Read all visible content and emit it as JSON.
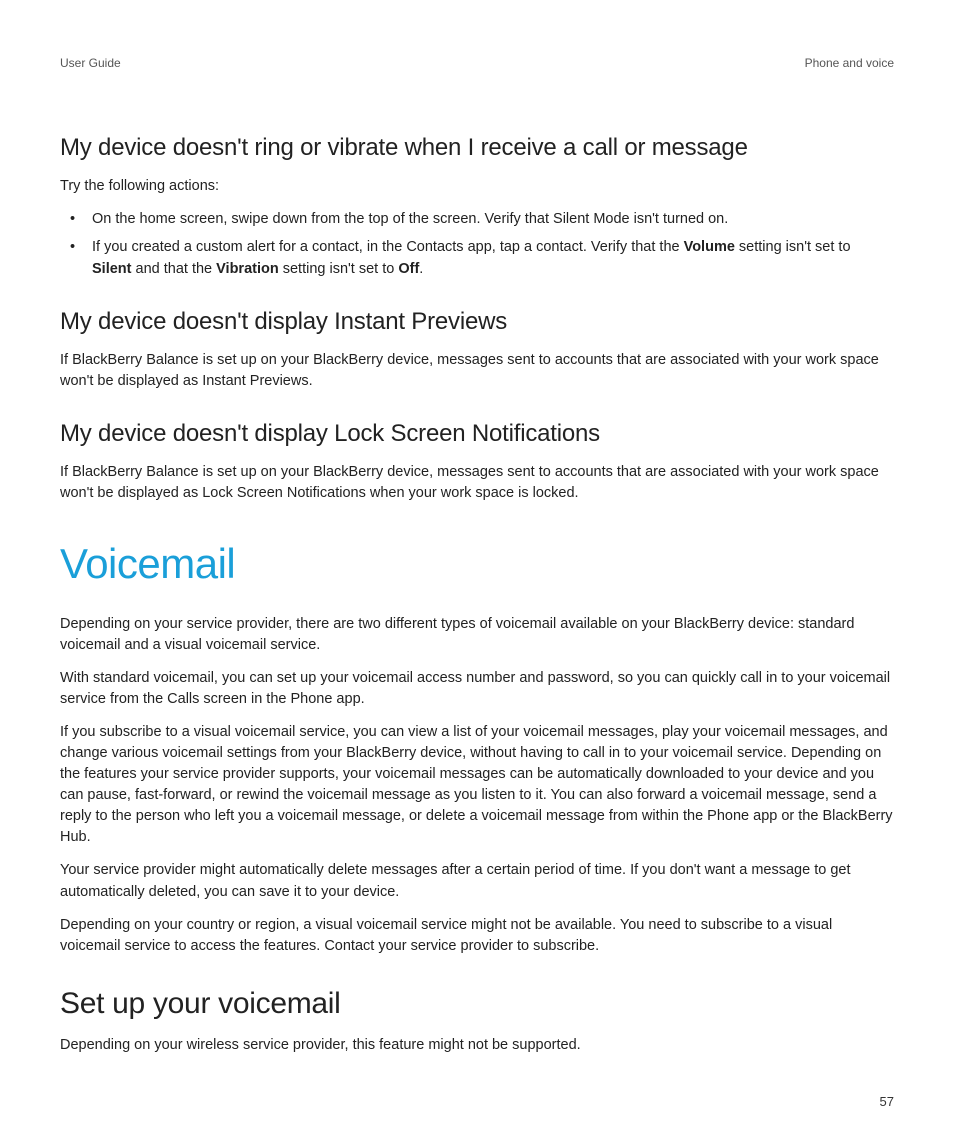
{
  "header": {
    "left": "User Guide",
    "right": "Phone and voice"
  },
  "section1": {
    "title": "My device doesn't ring or vibrate when I receive a call or message",
    "intro": "Try the following actions:",
    "bullet1": "On the home screen, swipe down from the top of the screen. Verify that Silent Mode isn't turned on.",
    "bullet2": {
      "p1": "If you created a custom alert for a contact, in the Contacts app, tap a contact. Verify that the ",
      "b1": "Volume",
      "p2": " setting isn't set to ",
      "b2": "Silent",
      "p3": " and that the ",
      "b3": "Vibration",
      "p4": " setting isn't set to ",
      "b4": "Off",
      "p5": "."
    }
  },
  "section2": {
    "title": "My device doesn't display Instant Previews",
    "body": "If BlackBerry Balance is set up on your BlackBerry device, messages sent to accounts that are associated with your work space won't be displayed as Instant Previews."
  },
  "section3": {
    "title": "My device doesn't display Lock Screen Notifications",
    "body": "If BlackBerry Balance is set up on your BlackBerry device, messages sent to accounts that are associated with your work space won't be displayed as Lock Screen Notifications when your work space is locked."
  },
  "major": {
    "title": "Voicemail",
    "p1": "Depending on your service provider, there are two different types of voicemail available on your BlackBerry device: standard voicemail and a visual voicemail service.",
    "p2": "With standard voicemail, you can set up your voicemail access number and password, so you can quickly call in to your voicemail service from the Calls screen in the Phone app.",
    "p3": "If you subscribe to a visual voicemail service, you can view a list of your voicemail messages, play your voicemail messages, and change various voicemail settings from your BlackBerry device, without having to call in to your voicemail service. Depending on the features your service provider supports, your voicemail messages can be automatically downloaded to your device and you can pause, fast-forward, or rewind the voicemail message as you listen to it. You can also forward a voicemail message, send a reply to the person who left you a voicemail message, or delete a voicemail message from within the Phone app or the BlackBerry Hub.",
    "p4": "Your service provider might automatically delete messages after a certain period of time. If you don't want a message to get automatically deleted, you can save it to your device.",
    "p5": "Depending on your country or region, a visual voicemail service might not be available. You need to subscribe to a visual voicemail service to access the features. Contact your service provider to subscribe."
  },
  "sub": {
    "title": "Set up your voicemail",
    "body": "Depending on your wireless service provider, this feature might not be supported."
  },
  "page": "57"
}
